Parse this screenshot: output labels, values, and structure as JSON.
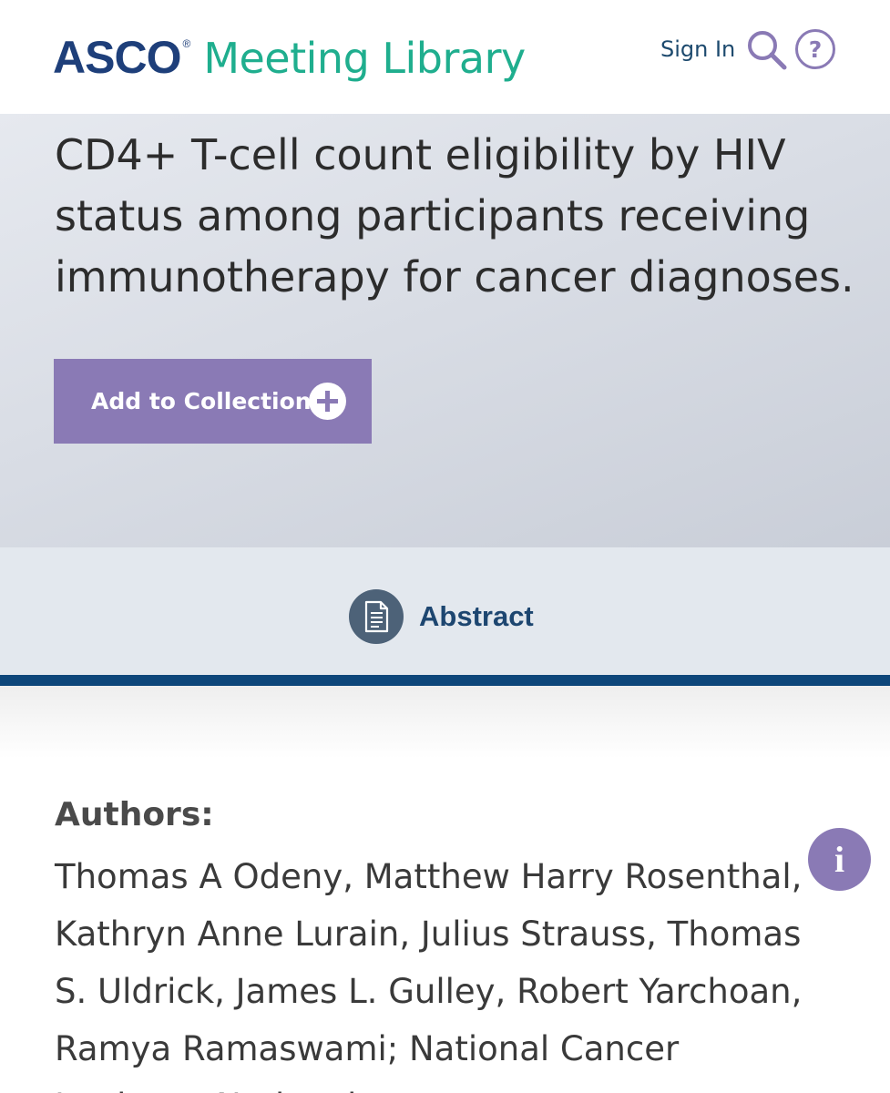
{
  "header": {
    "logo_brand": "ASCO",
    "logo_reg": "®",
    "logo_product": "Meeting Library",
    "signin_label": "Sign In"
  },
  "hero": {
    "title": "CD4+ T-cell count eligibility by HIV status among participants receiving immunotherapy for cancer diagnoses.",
    "collection_button_label": "Add to Collection"
  },
  "tabs": {
    "abstract_label": "Abstract"
  },
  "authors": {
    "heading": "Authors:",
    "text": "Thomas A Odeny, Matthew Harry Rosenthal, Kathryn Anne Lurain, Julius Strauss, Thomas S. Uldrick, James L. Gulley, Robert Yarchoan, Ramya Ramaswami; National Cancer Institute, National"
  },
  "info_button_glyph": "i",
  "colors": {
    "brand_navy": "#1e3f7a",
    "brand_teal": "#1fae8e",
    "accent_purple": "#8a7ab5",
    "tab_underline": "#0d467a"
  },
  "icons": [
    "search-icon",
    "help-icon",
    "plus-circle-icon",
    "document-icon",
    "info-icon"
  ]
}
